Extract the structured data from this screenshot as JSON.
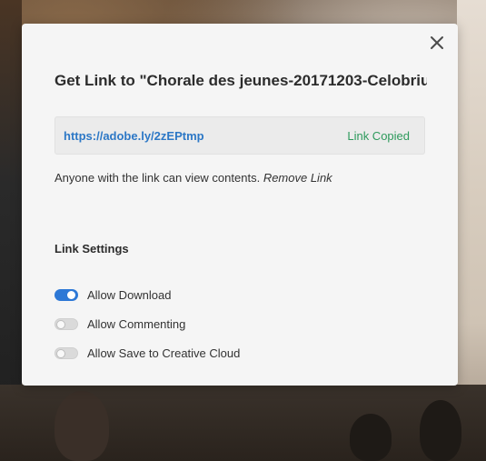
{
  "dialog": {
    "title": "Get Link to \"Chorale des jeunes-20171203-Celobriu...",
    "link_url": "https://adobe.ly/2zEPtmp",
    "link_status": "Link Copied",
    "info_text": "Anyone with the link can view contents.",
    "remove_link_label": "Remove Link",
    "settings_heading": "Link Settings",
    "settings": [
      {
        "label": "Allow Download",
        "enabled": true
      },
      {
        "label": "Allow Commenting",
        "enabled": false
      },
      {
        "label": "Allow Save to Creative Cloud",
        "enabled": false
      }
    ],
    "close_icon": "close-icon"
  },
  "colors": {
    "accent": "#2d78d6",
    "link": "#2d78c6",
    "success": "#2e9a5c",
    "dialog_bg": "#f5f5f5"
  }
}
